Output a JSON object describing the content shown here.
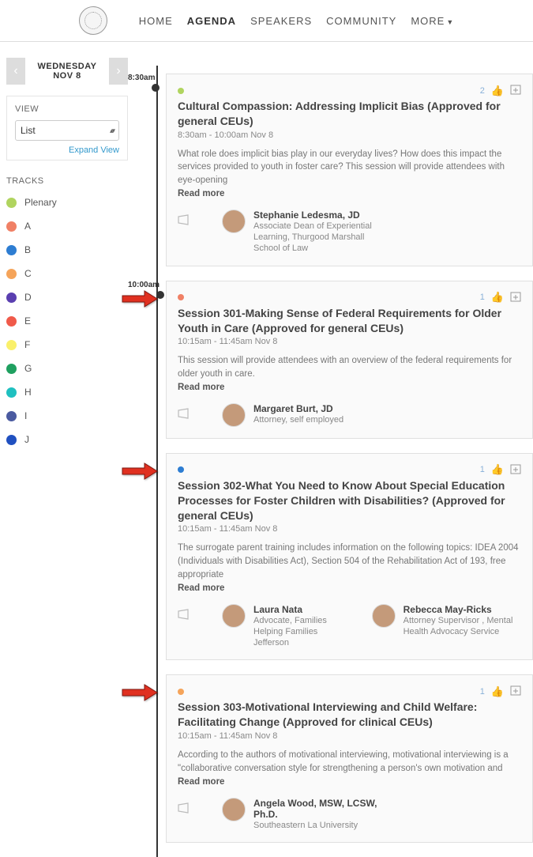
{
  "nav": {
    "items": [
      "HOME",
      "AGENDA",
      "SPEAKERS",
      "COMMUNITY",
      "MORE"
    ],
    "active": "AGENDA"
  },
  "date_nav": {
    "label": "WEDNESDAY NOV 8"
  },
  "view_panel": {
    "title": "VIEW",
    "select_value": "List",
    "expand": "Expand View"
  },
  "tracks": {
    "title": "TRACKS",
    "items": [
      {
        "label": "Plenary",
        "color": "#b0d45f"
      },
      {
        "label": "A",
        "color": "#f08065"
      },
      {
        "label": "B",
        "color": "#2d7dd2"
      },
      {
        "label": "C",
        "color": "#f5a45a"
      },
      {
        "label": "D",
        "color": "#5a3fb0"
      },
      {
        "label": "E",
        "color": "#f05a4a"
      },
      {
        "label": "F",
        "color": "#faf06a"
      },
      {
        "label": "G",
        "color": "#1fa060"
      },
      {
        "label": "H",
        "color": "#1fc0c0"
      },
      {
        "label": "I",
        "color": "#4a5aa0"
      },
      {
        "label": "J",
        "color": "#2050c0"
      }
    ]
  },
  "timeline": [
    {
      "time": "8:30am",
      "sessions": [
        {
          "track_color": "#b0d45f",
          "likes": "2",
          "title": "Cultural Compassion: Addressing Implicit Bias (Approved for general CEUs)",
          "time": "8:30am - 10:00am Nov 8",
          "desc": "What role does implicit bias play in our everyday lives? How does this impact the services provided to youth in foster care? This session will provide attendees with eye-opening",
          "read_more": "Read more",
          "arrow": false,
          "speakers": [
            {
              "name": "Stephanie Ledesma, JD",
              "role": "Associate Dean of Experiential Learning, Thurgood Marshall School of Law"
            }
          ]
        }
      ]
    },
    {
      "time": "10:00am",
      "sessions": [
        {
          "track_color": "#f08065",
          "likes": "1",
          "title": "Session 301-Making Sense of Federal Requirements for Older Youth in Care (Approved for general CEUs)",
          "time": "10:15am - 11:45am Nov 8",
          "desc": "This session will provide attendees with an overview of the federal requirements for older youth in care.",
          "read_more": "Read more",
          "arrow": true,
          "speakers": [
            {
              "name": "Margaret Burt, JD",
              "role": "Attorney, self employed"
            }
          ]
        },
        {
          "track_color": "#2d7dd2",
          "likes": "1",
          "title": "Session 302-What You Need to Know About Special Education Processes for Foster Children with Disabilities? (Approved for general CEUs)",
          "time": "10:15am - 11:45am Nov 8",
          "desc": "The surrogate parent training includes information on the following topics: IDEA 2004 (Individuals with Disabilities Act), Section 504 of the Rehabilitation Act of 193, free appropriate",
          "read_more": "Read more",
          "arrow": true,
          "speakers": [
            {
              "name": "Laura Nata",
              "role": "Advocate, Families Helping Families Jefferson"
            },
            {
              "name": "Rebecca May-Ricks",
              "role": "Attorney Supervisor , Mental Health Advocacy Service"
            }
          ]
        },
        {
          "track_color": "#f5a45a",
          "likes": "1",
          "title": "Session 303-Motivational Interviewing and Child Welfare: Facilitating Change (Approved for clinical CEUs)",
          "time": "10:15am - 11:45am Nov 8",
          "desc": "According to the authors of motivational interviewing, motivational interviewing is a \"collaborative conversation style for strengthening a person's own motivation and",
          "read_more": "Read more",
          "arrow": true,
          "speakers": [
            {
              "name": "Angela Wood, MSW, LCSW, Ph.D.",
              "role": "Southeastern La University"
            }
          ]
        }
      ]
    }
  ]
}
